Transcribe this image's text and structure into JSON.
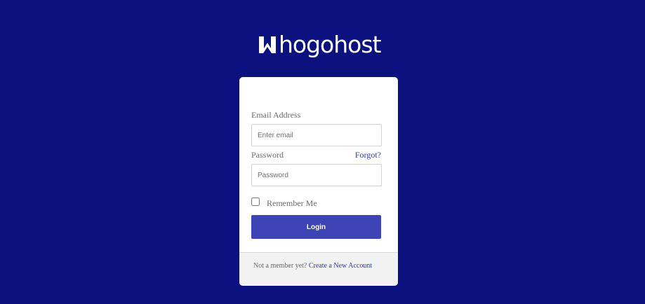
{
  "brand": {
    "name": "hogohost",
    "logo_icon": "whogohost-w-mark",
    "logo_alt": "Whogohost"
  },
  "colors": {
    "background": "#0b1280",
    "button": "#3d44b5",
    "link": "#2a3bb0"
  },
  "form": {
    "email_label": "Email Address",
    "email_placeholder": "Enter email",
    "email_value": "",
    "password_label": "Password",
    "forgot_label": "Forgot?",
    "password_placeholder": "Password",
    "password_value": "",
    "remember_label": "Remember Me",
    "remember_checked": false,
    "login_label": "Login"
  },
  "footer": {
    "prompt": "Not a member yet?",
    "link_label": "Create a New Account"
  }
}
